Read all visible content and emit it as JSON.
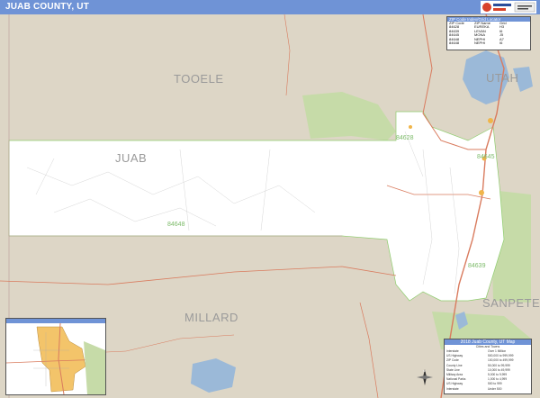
{
  "header": {
    "title": "JUAB COUNTY, UT"
  },
  "logo": {
    "name": "market-maps-logo"
  },
  "counties": {
    "tooele": "TOOELE",
    "juab": "JUAB",
    "millard": "MILLARD",
    "sanpete": "SANPETE",
    "utah": "UTAH"
  },
  "zip_labels": {
    "z84628": "84628",
    "z84648": "84648",
    "z84639": "84639",
    "z84645": "84645"
  },
  "zip_locator": {
    "title": "ZIP Code Index/Grid Locator",
    "headers": [
      "ZIP Code",
      "ZIP Name",
      "Grid"
    ],
    "rows": [
      [
        "84628",
        "EUREKA",
        "H3"
      ],
      [
        "84639",
        "LEVAN",
        "I6"
      ],
      [
        "84645",
        "MONA",
        "J5"
      ],
      [
        "84648",
        "NEPHI",
        "A7"
      ],
      [
        "84648",
        "NEPHI",
        "I6"
      ]
    ]
  },
  "legend": {
    "title": "2018 Juab County, UT Map",
    "subtitle": "Cities and Towns",
    "rows": [
      [
        "Interstate",
        "Over 1 Million"
      ],
      [
        "US Highway",
        "500,000 to 999,999"
      ],
      [
        "ZIP Code",
        "100,000 to 499,999"
      ],
      [
        "County Line",
        "50,000 to 99,999"
      ],
      [
        "State Line",
        "10,000 to 49,999"
      ],
      [
        "Military Area",
        "5,000 to 9,999"
      ],
      [
        "National Parks",
        "1,000 to 4,999"
      ],
      [
        "US Highway",
        "500 to 999"
      ],
      [
        "Interstate",
        "Under 500"
      ]
    ]
  },
  "colors": {
    "header": "#6f93d6",
    "land": "#ddd6c6",
    "county_focus": "#ffffff",
    "forest": "#c6dba8",
    "water": "#9bb9d8",
    "highway": "#d97b5e",
    "zip_boundary": "#8fcd6e"
  }
}
